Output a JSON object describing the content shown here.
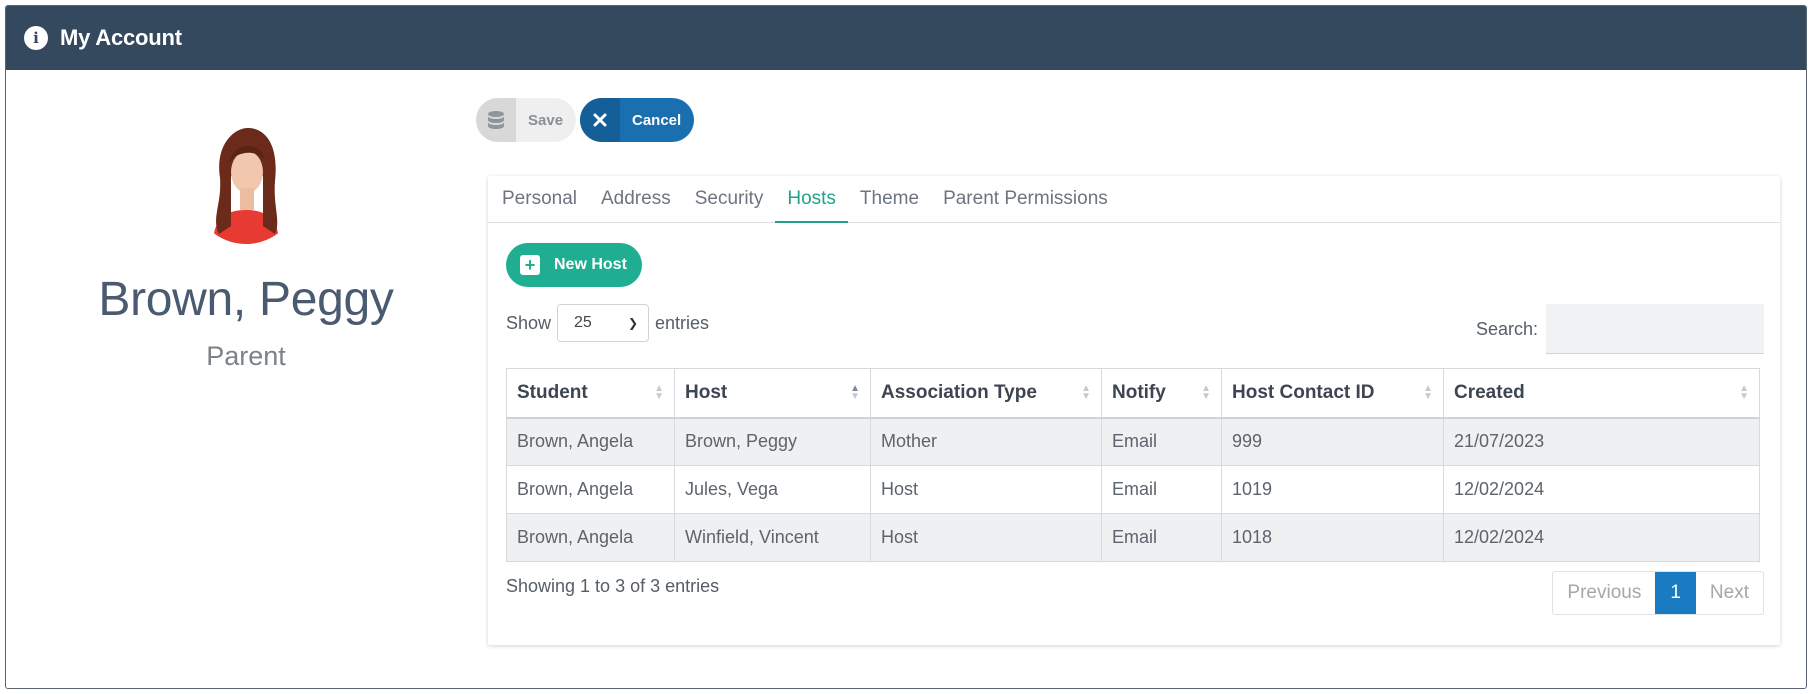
{
  "header": {
    "title": "My Account",
    "icon": "info-icon"
  },
  "profile": {
    "name": "Brown, Peggy",
    "role": "Parent"
  },
  "actions": {
    "save_label": "Save",
    "cancel_label": "Cancel"
  },
  "tabs": [
    {
      "label": "Personal"
    },
    {
      "label": "Address"
    },
    {
      "label": "Security"
    },
    {
      "label": "Hosts"
    },
    {
      "label": "Theme"
    },
    {
      "label": "Parent Permissions"
    }
  ],
  "active_tab": "Hosts",
  "new_host_label": "New Host",
  "length": {
    "show_label": "Show",
    "value": "25",
    "entries_label": "entries"
  },
  "search": {
    "label": "Search:",
    "placeholder": ""
  },
  "table": {
    "columns": [
      "Student",
      "Host",
      "Association Type",
      "Notify",
      "Host Contact ID",
      "Created"
    ],
    "rows": [
      [
        "Brown, Angela",
        "Brown, Peggy",
        "Mother",
        "Email",
        "999",
        "21/07/2023"
      ],
      [
        "Brown, Angela",
        "Jules, Vega",
        "Host",
        "Email",
        "1019",
        "12/02/2024"
      ],
      [
        "Brown, Angela",
        "Winfield, Vincent",
        "Host",
        "Email",
        "1018",
        "12/02/2024"
      ]
    ]
  },
  "footer": {
    "info": "Showing 1 to 3 of 3 entries",
    "previous": "Previous",
    "page": "1",
    "next": "Next"
  },
  "colors": {
    "header_bg": "#34495e",
    "accent_teal": "#1fae91",
    "cancel_blue": "#1a6fb0",
    "page_active": "#1a7ac2"
  }
}
